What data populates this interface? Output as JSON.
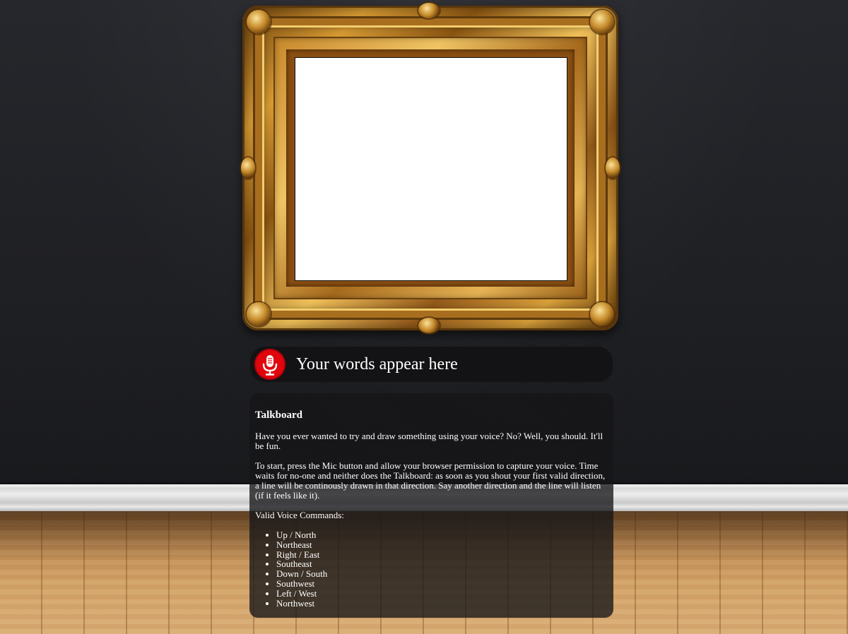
{
  "app": {
    "name": "Talkboard"
  },
  "speech": {
    "transcript": "Your words appear here",
    "mic_icon": "microphone-icon",
    "mic_color": "#e1060e"
  },
  "info": {
    "title": "Talkboard",
    "paragraph1": "Have you ever wanted to try and draw something using your voice? No? Well, you should. It'll be fun.",
    "paragraph2": "To start, press the Mic button and allow your browser permission to capture your voice. Time waits for no-one and neither does the Talkboard: as soon as you shout your first valid direction, a line will be continously drawn in that direction. Say another direction and the line will listen (if it feels like it).",
    "commands_heading": "Valid Voice Commands:",
    "commands": [
      "Up / North",
      "Northeast",
      "Right / East",
      "Southeast",
      "Down / South",
      "Southwest",
      "Left / West",
      "Northwest"
    ]
  },
  "colors": {
    "canvas": "#ffffff",
    "wall": "#1d1e22",
    "panel": "rgba(22,22,24,0.78)"
  }
}
